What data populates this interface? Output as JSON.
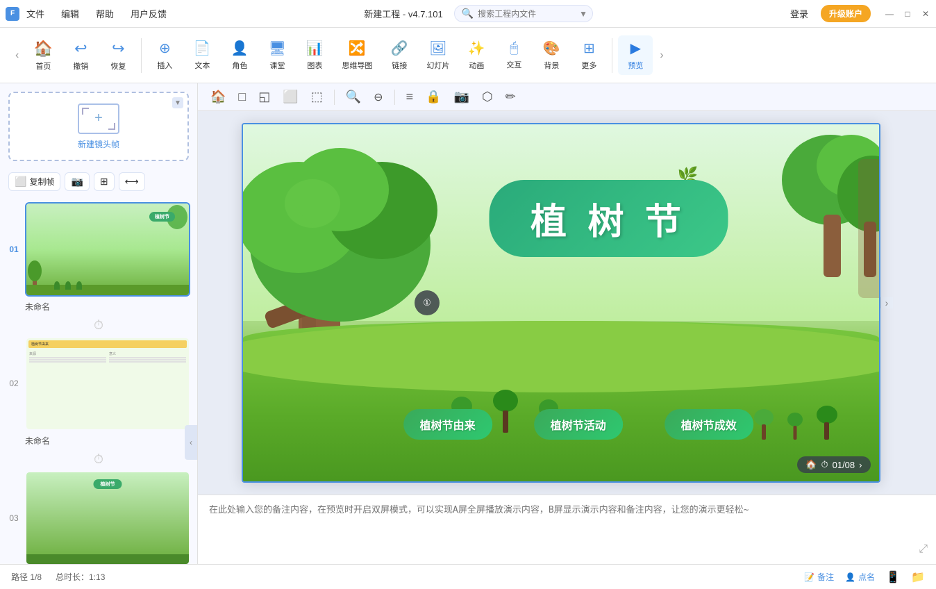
{
  "app": {
    "title": "新建工程 - v4.7.101",
    "logo_text": "FIt"
  },
  "titlebar": {
    "menu_items": [
      "文件",
      "编辑",
      "帮助",
      "用户反馈"
    ],
    "search_placeholder": "搜索工程内文件",
    "login_label": "登录",
    "upgrade_label": "升级账户"
  },
  "toolbar": {
    "items": [
      {
        "id": "home",
        "icon": "🏠",
        "label": "首页"
      },
      {
        "id": "undo",
        "icon": "↩",
        "label": "撤销"
      },
      {
        "id": "redo",
        "icon": "↪",
        "label": "恢复"
      },
      {
        "id": "insert",
        "icon": "➕",
        "label": "插入"
      },
      {
        "id": "text",
        "icon": "📝",
        "label": "文本"
      },
      {
        "id": "role",
        "icon": "👤",
        "label": "角色"
      },
      {
        "id": "class",
        "icon": "🖥",
        "label": "课堂"
      },
      {
        "id": "chart",
        "icon": "📊",
        "label": "图表"
      },
      {
        "id": "mindmap",
        "icon": "🧠",
        "label": "思维导图"
      },
      {
        "id": "link",
        "icon": "🔗",
        "label": "链接"
      },
      {
        "id": "slide",
        "icon": "🖼",
        "label": "幻灯片"
      },
      {
        "id": "animation",
        "icon": "⭐",
        "label": "动画"
      },
      {
        "id": "interact",
        "icon": "🖱",
        "label": "交互"
      },
      {
        "id": "bg",
        "icon": "🖼",
        "label": "背景"
      },
      {
        "id": "more",
        "icon": "⊞",
        "label": "更多"
      },
      {
        "id": "preview",
        "icon": "▶",
        "label": "预览"
      }
    ]
  },
  "left_panel": {
    "new_frame_label": "新建镜头帧",
    "controls": [
      "复制帧",
      "📷",
      "⊞",
      "⟳"
    ],
    "slides": [
      {
        "num": "01",
        "name": "未命名",
        "active": true
      },
      {
        "num": "02",
        "name": "未命名",
        "active": false
      },
      {
        "num": "03",
        "name": "",
        "active": false
      }
    ]
  },
  "canvas": {
    "toolbar_icons": [
      "🏠",
      "□",
      "◱",
      "⬜",
      "⬚",
      "🔍+",
      "🔍-",
      "≡",
      "🔒",
      "📷",
      "⬡",
      "✏"
    ],
    "slide_content": {
      "title": "植 树 节",
      "buttons": [
        "植树节由来",
        "植树节活动",
        "植树节成效"
      ],
      "slide_counter": "01/08"
    }
  },
  "notes": {
    "placeholder": "在此处输入您的备注内容，在预览时开启双屏模式，可以实现A屏全屏播放演示内容，B屏显示演示内容和备注内容，让您的演示更轻松~"
  },
  "statusbar": {
    "path": "路径 1/8",
    "duration": "总时长：1:13",
    "notes_btn": "备注",
    "rollcall_btn": "点名",
    "screen_btn": "",
    "folder_btn": ""
  }
}
